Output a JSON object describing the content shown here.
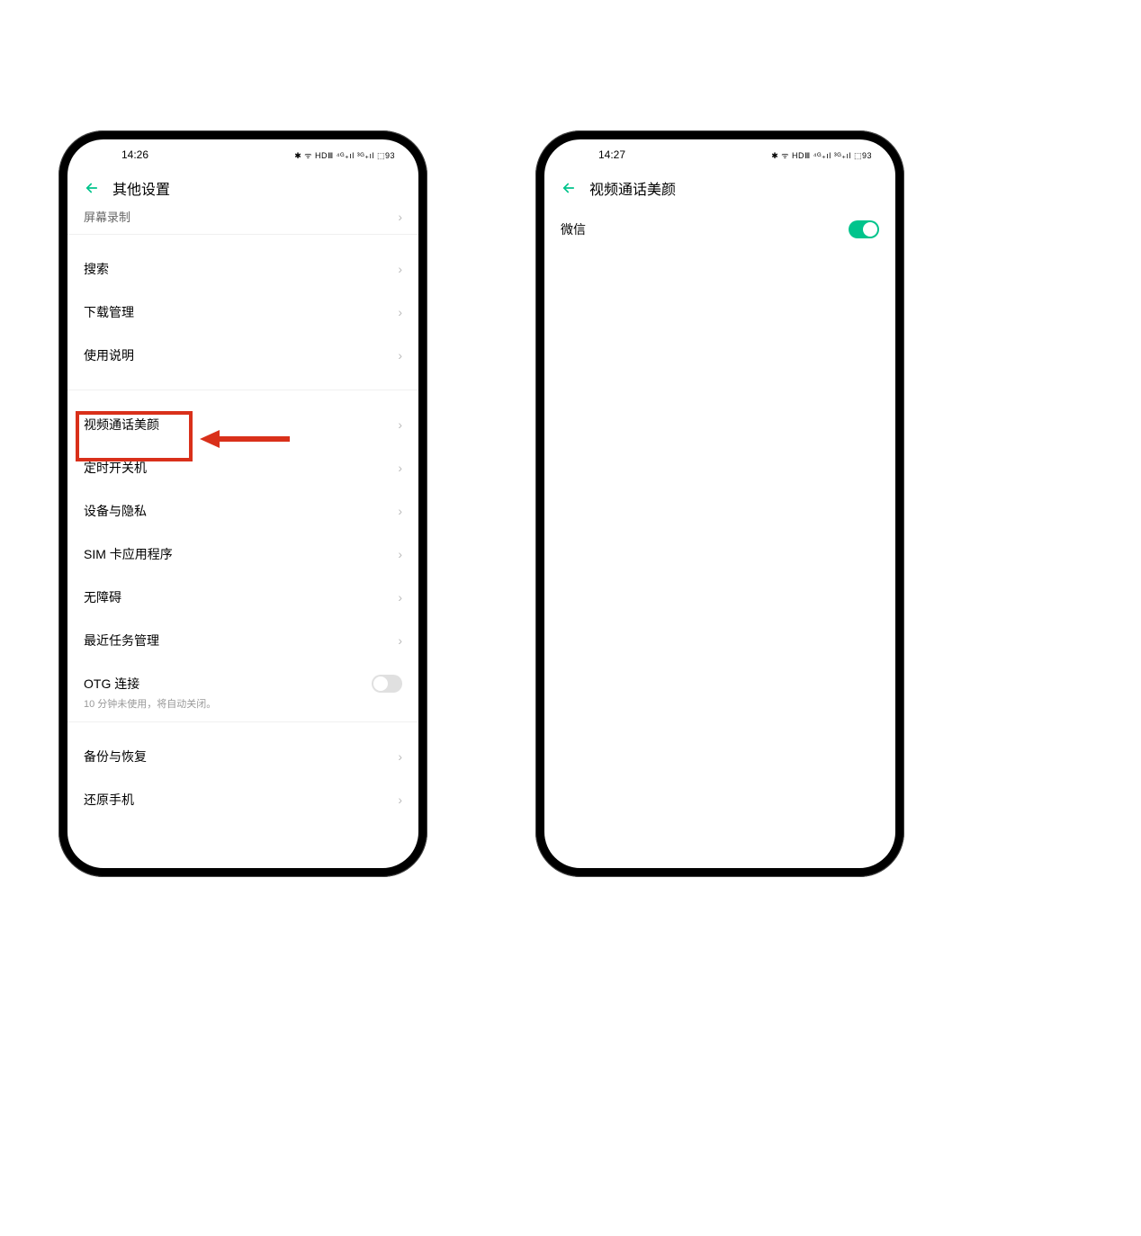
{
  "left": {
    "status": {
      "time": "14:26",
      "icons": "✱ ᯤ HDⅢ ⁴ᴳ₊ıl ³ᴳ₊ıl ⬚93"
    },
    "title": "其他设置",
    "partial_top": "屏幕录制",
    "groups": [
      [
        {
          "key": "search",
          "label": "搜索"
        },
        {
          "key": "download-manager",
          "label": "下载管理"
        },
        {
          "key": "instructions",
          "label": "使用说明"
        }
      ],
      [
        {
          "key": "video-call-beauty",
          "label": "视频通话美颜"
        },
        {
          "key": "scheduled-power",
          "label": "定时开关机"
        },
        {
          "key": "device-privacy",
          "label": "设备与隐私"
        },
        {
          "key": "sim-apps",
          "label": "SIM 卡应用程序"
        },
        {
          "key": "accessibility",
          "label": "无障碍"
        },
        {
          "key": "recent-tasks",
          "label": "最近任务管理"
        },
        {
          "key": "otg",
          "label": "OTG 连接",
          "type": "toggle",
          "on": false,
          "sub": "10 分钟未使用，将自动关闭。"
        }
      ],
      [
        {
          "key": "backup-restore",
          "label": "备份与恢复"
        },
        {
          "key": "reset-phone",
          "label": "还原手机"
        }
      ]
    ]
  },
  "right": {
    "status": {
      "time": "14:27",
      "icons": "✱ ᯤ HDⅢ ⁴ᴳ₊ıl ³ᴳ₊ıl ⬚93"
    },
    "title": "视频通话美颜",
    "rows": [
      {
        "key": "wechat",
        "label": "微信",
        "type": "toggle",
        "on": true
      }
    ]
  },
  "colors": {
    "accent": "#00c48c",
    "highlight": "#d9301a"
  }
}
